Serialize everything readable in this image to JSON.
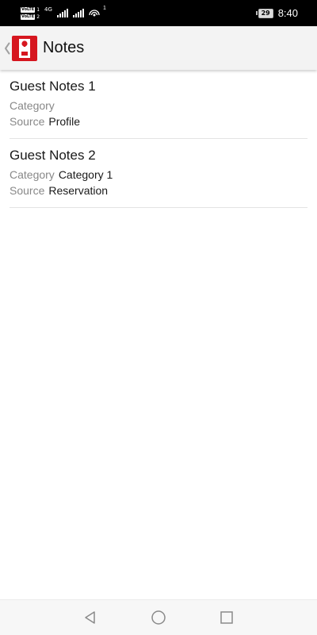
{
  "status_bar": {
    "volte_1": "VoLTE",
    "volte_2": "VoLTE",
    "sim_1": "1",
    "sim_2": "2",
    "network_type": "4G",
    "hotspot_count": "1",
    "battery_level": "29",
    "time": "8:40"
  },
  "app_bar": {
    "title": "Notes",
    "back_icon": "chevron-left-icon",
    "logo_icon": "door-hanger-icon",
    "brand_color": "#d6161f"
  },
  "notes": [
    {
      "title": "Guest Notes 1",
      "category_label": "Category",
      "category_value": "",
      "source_label": "Source",
      "source_value": "Profile"
    },
    {
      "title": "Guest Notes 2",
      "category_label": "Category",
      "category_value": "Category 1",
      "source_label": "Source",
      "source_value": "Reservation"
    }
  ],
  "nav_bar": {
    "back_icon": "triangle-back-icon",
    "home_icon": "circle-home-icon",
    "recents_icon": "square-recents-icon"
  }
}
